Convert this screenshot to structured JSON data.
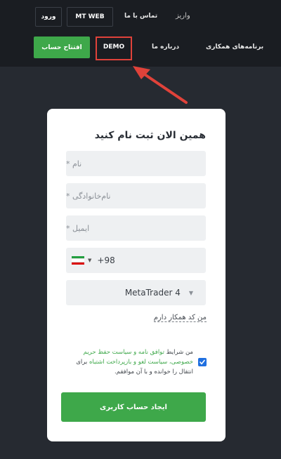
{
  "nav": {
    "login": "ورود",
    "mt_web": "MT WEB",
    "contact": "تماس با ما",
    "deposit": "واریز",
    "open_account": "افتتاح حساب",
    "demo": "DEMO",
    "about": "درباره ما",
    "partners": "برنامه‌های همکاری"
  },
  "form": {
    "title": "همین الان ثبت نام کنید",
    "first_name_placeholder": "نام *",
    "last_name_placeholder": "نام‌خانوادگی *",
    "email_placeholder": "ایمیل *",
    "phone_code": "+98",
    "platform_value": "MetaTrader 4",
    "partner_code_link": "من کد همکار دارم",
    "terms_prefix": "من شرایط",
    "terms_link": "توافق نامه و سیاست حفظ حریم خصوصی، سیاست لغو و بازپرداخت اشتباه",
    "terms_suffix": "برای انتقال را خوانده و با آن موافقم.",
    "terms_checked": true,
    "submit_label": "ایجاد حساب کاربری"
  },
  "colors": {
    "background": "#262a31",
    "topbar": "#1a1d22",
    "accent_green": "#3ea84a",
    "highlight_red": "#e0423a",
    "checkbox_blue": "#1f6fe0"
  },
  "icons": {
    "flag": "iran-flag-icon",
    "dropdown": "caret-down-icon",
    "check": "checkmark-icon",
    "annotation": "red-arrow-annotation"
  }
}
